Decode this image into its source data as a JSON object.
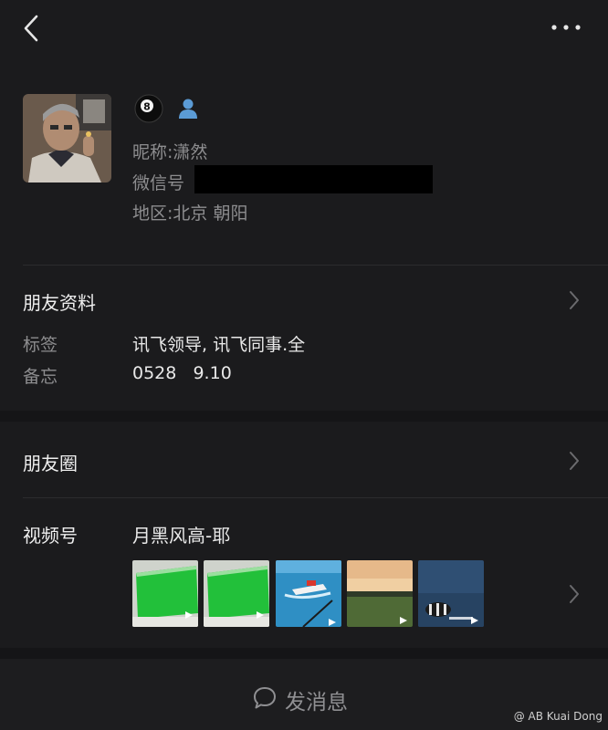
{
  "profile": {
    "nickname_label": "昵称:",
    "nickname": "潇然",
    "wechat_id_label": "微信号",
    "region_label": "地区:",
    "region": "北京 朝阳",
    "badge_text": "8"
  },
  "friend_info": {
    "title": "朋友资料",
    "tags_label": "标签",
    "tags_value": "讯飞领导, 讯飞同事.全",
    "memo_label": "备忘",
    "memo_value": "0528   9.10"
  },
  "moments": {
    "title": "朋友圈"
  },
  "channels": {
    "title": "视频号",
    "name": "月黑风高-耶",
    "thumbnails": [
      "green-screen",
      "green-screen",
      "speedboat-sea",
      "sunset-field",
      "fish-underwater"
    ]
  },
  "bottom": {
    "send_message": "发消息"
  },
  "watermark": "@ AB Kuai Dong",
  "colors": {
    "background": "#1b1b1d",
    "text": "#e8e8e8",
    "secondary_text": "#8d8d8f",
    "mask": "#000000"
  }
}
